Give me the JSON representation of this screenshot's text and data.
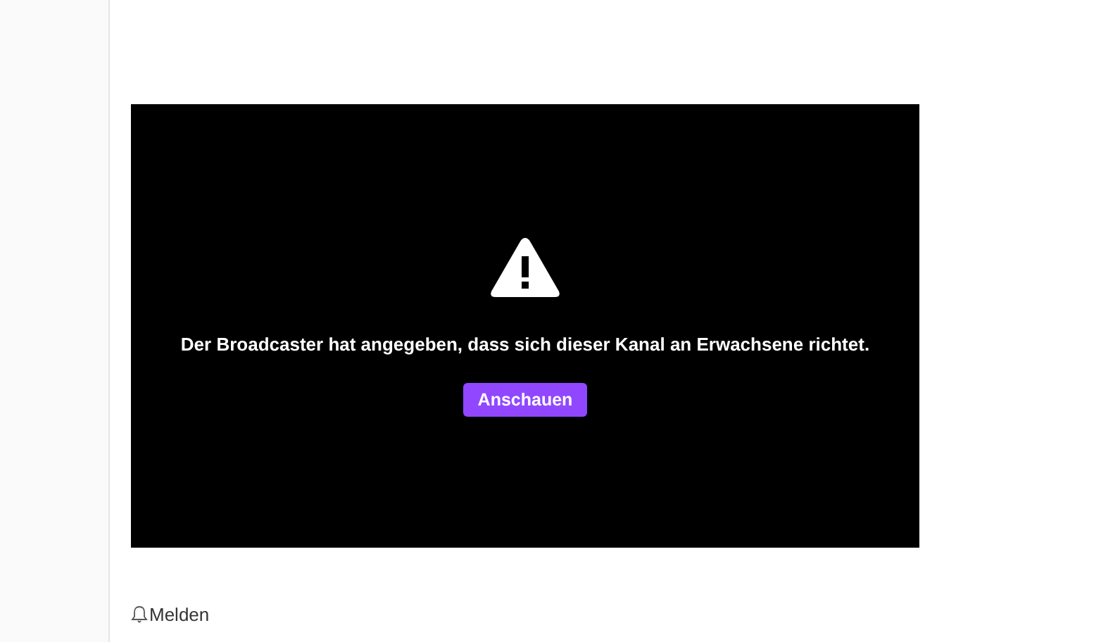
{
  "player": {
    "message": "Der Broadcaster hat angegeben, dass sich dieser Kanal an Erwachsene richtet.",
    "button": "Anschauen"
  },
  "report_link": "Melden"
}
